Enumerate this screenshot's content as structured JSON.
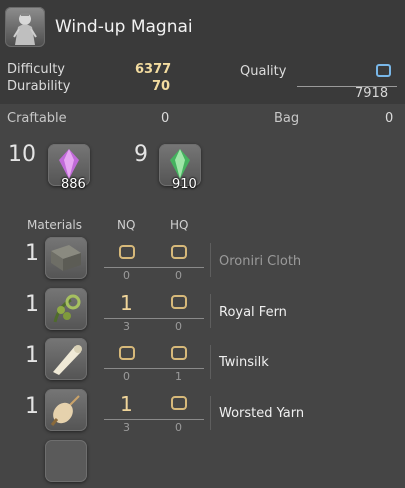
{
  "item": {
    "name": "Wind-up Magnai",
    "icon": "minion-figure-icon"
  },
  "stats": {
    "difficulty_label": "Difficulty",
    "difficulty": "6377",
    "durability_label": "Durability",
    "durability": "70",
    "quality_label": "Quality",
    "quality_max": "7918"
  },
  "summary": {
    "craftable_label": "Craftable",
    "craftable": "0",
    "bag_label": "Bag",
    "bag": "0"
  },
  "crystals": [
    {
      "required": "10",
      "icon": "purple-crystal-icon",
      "owned": "886"
    },
    {
      "required": "9",
      "icon": "green-crystal-icon",
      "owned": "910"
    }
  ],
  "headers": {
    "materials": "Materials",
    "nq": "NQ",
    "hq": "HQ"
  },
  "materials": [
    {
      "required": "1",
      "icon": "cloth-icon",
      "nq": "",
      "hq": "",
      "nq_have": "0",
      "hq_have": "0",
      "name": "Oroniri Cloth",
      "available": false
    },
    {
      "required": "1",
      "icon": "fern-icon",
      "nq": "1",
      "hq": "",
      "nq_have": "3",
      "hq_have": "0",
      "name": "Royal Fern",
      "available": true
    },
    {
      "required": "1",
      "icon": "silk-roll-icon",
      "nq": "",
      "hq": "",
      "nq_have": "0",
      "hq_have": "1",
      "name": "Twinsilk",
      "available": true
    },
    {
      "required": "1",
      "icon": "yarn-spindle-icon",
      "nq": "1",
      "hq": "",
      "nq_have": "3",
      "hq_have": "0",
      "name": "Worsted Yarn",
      "available": true
    }
  ],
  "colors": {
    "accent_gold": "#d7b97a",
    "quality_blue": "#79b7e8",
    "panel": "#454545"
  }
}
